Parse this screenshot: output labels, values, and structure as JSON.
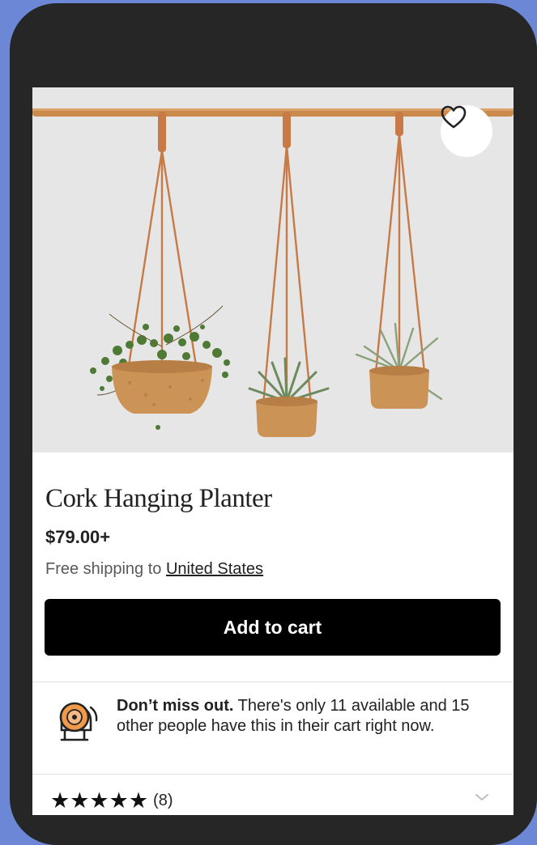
{
  "product": {
    "title": "Cork Hanging Planter",
    "price": "$79.00+",
    "shipping_prefix": "Free shipping to ",
    "shipping_destination": "United States",
    "add_to_cart_label": "Add to cart"
  },
  "alert": {
    "headline": "Don’t miss out.",
    "message": " There's only 11 available and 15 other people have this in their cart right now."
  },
  "reviews": {
    "stars_display": "★★★★★",
    "rating": 5,
    "count_label": "(8)"
  },
  "icons": {
    "favorite": "heart-outline-icon",
    "alert": "alarm-bell-icon",
    "expand": "chevron-down-icon"
  },
  "colors": {
    "background": "#6b87d6",
    "phone_frame": "#262626",
    "button": "#000000",
    "alert_accent": "#f0994a"
  }
}
